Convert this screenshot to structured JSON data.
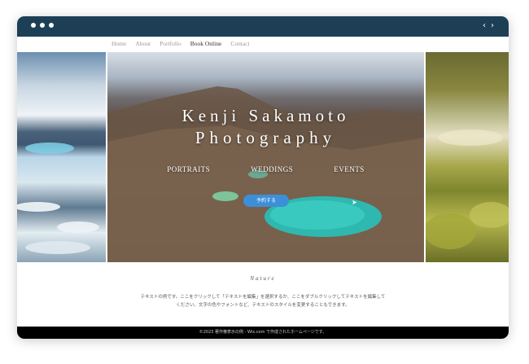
{
  "window": {
    "controls": [
      "close",
      "minimize",
      "maximize"
    ],
    "nav_arrows": [
      "‹",
      "›"
    ]
  },
  "nav": {
    "items": [
      "Home",
      "About",
      "Portfolio",
      "Book Online",
      "Contact"
    ],
    "active": "Book Online"
  },
  "hero": {
    "title_line1": "Kenji Sakamoto",
    "title_line2": "Photography",
    "links": [
      "PORTRAITS",
      "WEDDINGS",
      "EVENTS"
    ],
    "cta_label": "予約する"
  },
  "section": {
    "title": "Nature",
    "body": "テキストの例です。ここをクリックして「テキストを編集」を選択するか、ここをダブルクリックしてテキストを編集してください。文字の色やフォントなど、テキストのスタイルを変更することもできます。"
  },
  "footer": {
    "text": "©2023 著作権表示の例 - Wix.com で作成されたホームページです。"
  },
  "colors": {
    "titlebar": "#1c3f55",
    "cta": "#3d8fd8",
    "footer": "#000000"
  }
}
